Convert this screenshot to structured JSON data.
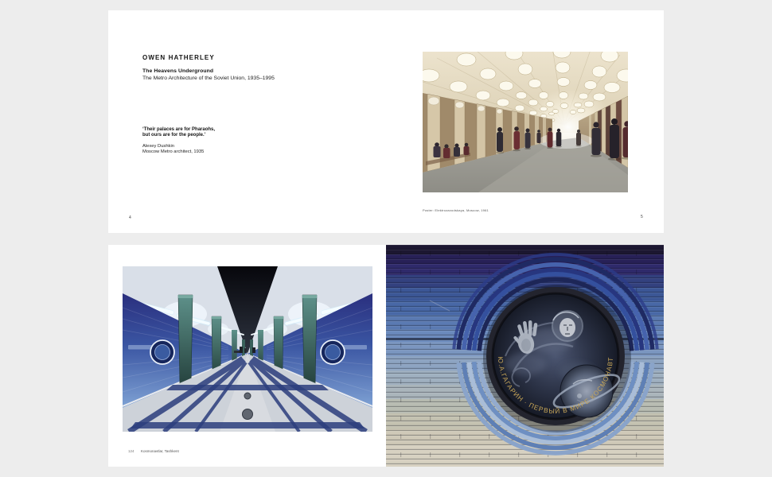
{
  "top_spread": {
    "author": "OWEN HATHERLEY",
    "title": "The Heavens Underground",
    "subtitle": "The Metro Architecture of the Soviet Union, 1935–1995",
    "quote": {
      "line1": "‘Their palaces are for Pharaohs,",
      "line2": "but ours are for the people.’",
      "source_name": "Alexey Dushkin",
      "source_role": "Moscow Metro architect, 1935"
    },
    "plate_caption": "Poster: Elektrozavodskaya, Moscow, 1961",
    "page_number_left": "4",
    "page_number_right": "5"
  },
  "bottom_spread": {
    "page_number": "124",
    "caption": "Kosmonavtlar, Tashkent",
    "medallion_inscription": "Ю.А.ГАГАРИН · ПЕРВЫЙ В МИРЕ КОСМОНАВТ"
  },
  "palette": {
    "canvas_bg": "#ededed",
    "page_bg": "#ffffff",
    "ink": "#141414",
    "caption_gray": "#555555",
    "metro_cream": "#e9e0cb",
    "kosmonavtlar_blue": "#3a55a2",
    "floor_navy": "#2c3e7d",
    "ribbed_wall_dark": "#272057",
    "ribbed_wall_light": "#d7d1c1",
    "medallion_gold": "#c9a758"
  }
}
